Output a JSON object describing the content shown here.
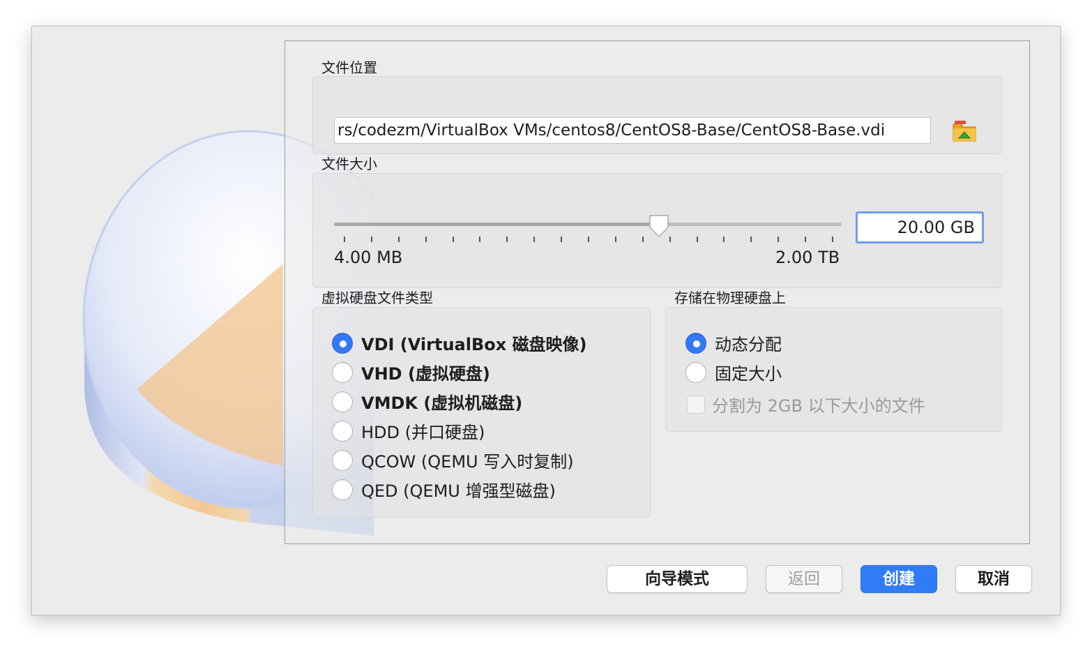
{
  "location": {
    "label": "文件位置",
    "path": "rs/codezm/VirtualBox VMs/centos8/CentOS8-Base/CentOS8-Base.vdi",
    "folder_icon": "folder-icon"
  },
  "size": {
    "label": "文件大小",
    "min_label": "4.00 MB",
    "max_label": "2.00 TB",
    "value": "20.00 GB",
    "slider_fraction": 0.64,
    "tick_count": 19
  },
  "disk_type": {
    "label": "虚拟硬盘文件类型",
    "options": [
      {
        "label": "VDI (VirtualBox 磁盘映像)",
        "checked": true
      },
      {
        "label": "VHD (虚拟硬盘)",
        "checked": false
      },
      {
        "label": "VMDK (虚拟机磁盘)",
        "checked": false
      },
      {
        "label": "HDD (并口硬盘)",
        "checked": false
      },
      {
        "label": "QCOW (QEMU 写入时复制)",
        "checked": false
      },
      {
        "label": "QED (QEMU 增强型磁盘)",
        "checked": false
      }
    ]
  },
  "storage": {
    "label": "存储在物理硬盘上",
    "options": [
      {
        "label": "动态分配",
        "checked": true
      },
      {
        "label": "固定大小",
        "checked": false
      }
    ],
    "split_checkbox": {
      "label": "分割为 2GB 以下大小的文件",
      "checked": false,
      "enabled": false
    }
  },
  "buttons": {
    "guided": "向导模式",
    "back": "返回",
    "create": "创建",
    "cancel": "取消"
  },
  "colors": {
    "accent": "#2f7cf6",
    "disk_art_orange": "#f3c48c",
    "disk_art_blue": "#bccbee"
  }
}
